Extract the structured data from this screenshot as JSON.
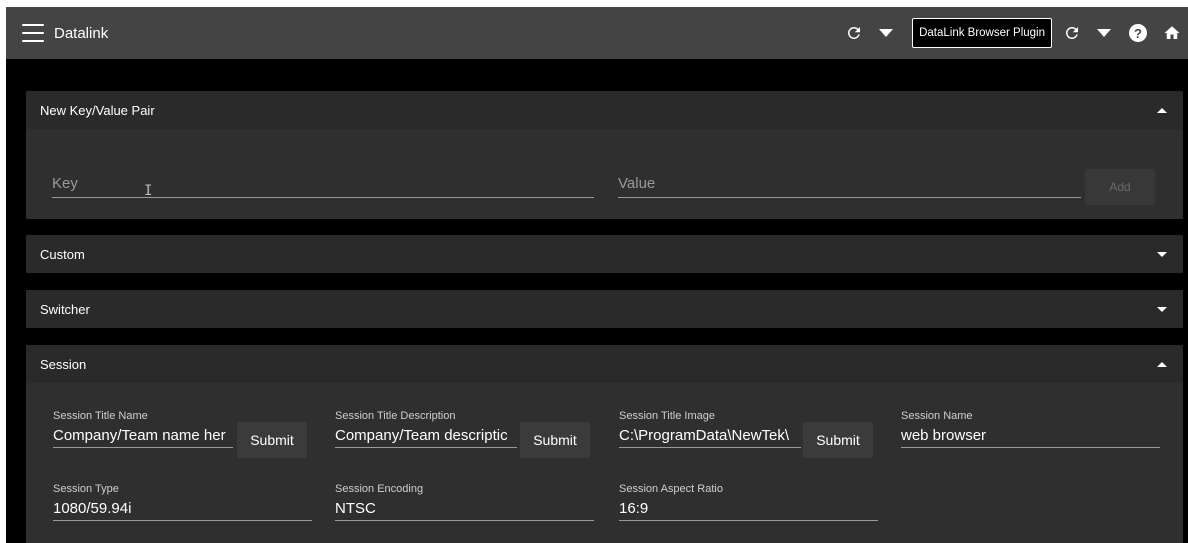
{
  "app": {
    "title": "Datalink"
  },
  "toolbar": {
    "plugin_label": "DataLink Browser Plugin"
  },
  "panels": {
    "new_kv": {
      "title": "New Key/Value Pair",
      "key_placeholder": "Key",
      "value_placeholder": "Value",
      "add_label": "Add"
    },
    "custom": {
      "title": "Custom"
    },
    "switcher": {
      "title": "Switcher"
    },
    "session": {
      "title": "Session",
      "submit_label": "Submit",
      "fields": {
        "title_name": {
          "label": "Session Title Name",
          "value": "Company/Team name her"
        },
        "title_description": {
          "label": "Session Title Description",
          "value": "Company/Team descriptic"
        },
        "title_image": {
          "label": "Session Title Image",
          "value": "C:\\ProgramData\\NewTek\\"
        },
        "name": {
          "label": "Session Name",
          "value": "web browser"
        },
        "type": {
          "label": "Session Type",
          "value": "1080/59.94i"
        },
        "encoding": {
          "label": "Session Encoding",
          "value": "NTSC"
        },
        "aspect_ratio": {
          "label": "Session Aspect Ratio",
          "value": "16:9"
        }
      }
    }
  },
  "icons": {
    "menu": "hamburger-icon",
    "refresh": "refresh-icon",
    "dropdown": "caret-down-icon",
    "help": "help-circle-icon",
    "home": "home-icon",
    "collapse": "caret-up-icon",
    "expand": "caret-down-icon"
  }
}
